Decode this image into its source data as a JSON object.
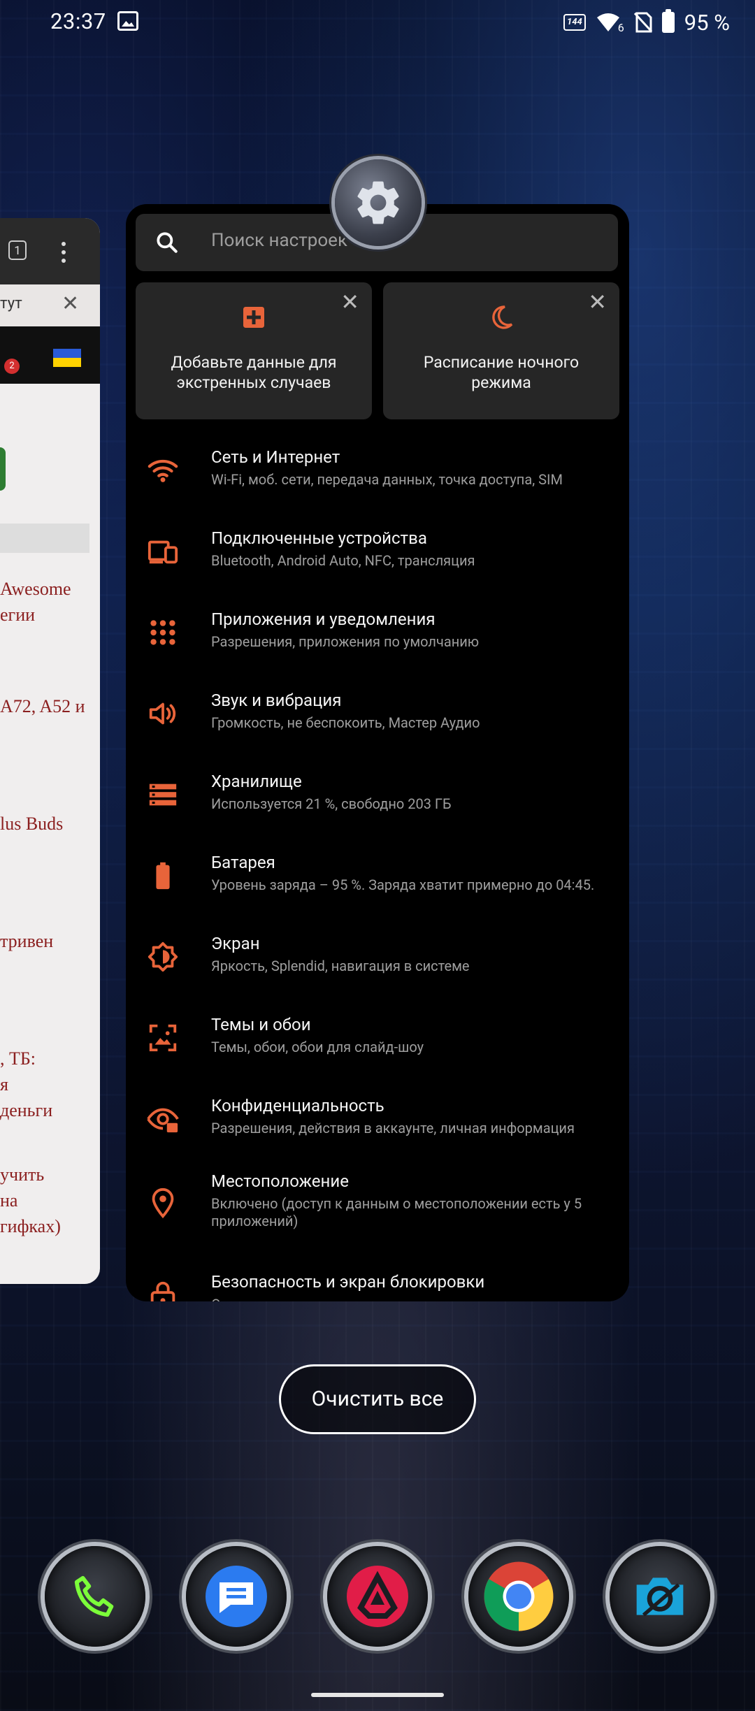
{
  "status_bar": {
    "time": "23:37",
    "refresh_rate": "144",
    "network": "6",
    "battery": "95 %"
  },
  "left_card": {
    "tab_count": "1",
    "tab_title": "тут",
    "close": "✕",
    "badge": "2",
    "snippets": [
      "Awesome",
      "егии",
      "A72, A52 и",
      "lus Buds",
      "тривен",
      ", ТБ:",
      "я",
      "деньги",
      "учить",
      "на",
      " гифках)"
    ]
  },
  "settings": {
    "search_placeholder": "Поиск настроек",
    "suggestions": [
      {
        "text": "Добавьте данные для экстренных случаев",
        "icon": "medical-cross-icon",
        "close": "✕"
      },
      {
        "text": "Расписание ночного режима",
        "icon": "moon-icon",
        "close": "✕"
      }
    ],
    "items": [
      {
        "title": "Сеть и Интернет",
        "subtitle": "Wi-Fi, моб. сети, передача данных, точка доступа, SIM",
        "icon": "wifi-icon"
      },
      {
        "title": "Подключенные устройства",
        "subtitle": "Bluetooth, Android Auto, NFC, трансляция",
        "icon": "devices-icon"
      },
      {
        "title": "Приложения и уведомления",
        "subtitle": "Разрешения, приложения по умолчанию",
        "icon": "apps-grid-icon"
      },
      {
        "title": "Звук и вибрация",
        "subtitle": "Громкость, не беспокоить, Мастер Аудио",
        "icon": "speaker-icon"
      },
      {
        "title": "Хранилище",
        "subtitle": "Используется 21 %, свободно 203 ГБ",
        "icon": "storage-icon"
      },
      {
        "title": "Батарея",
        "subtitle": "Уровень заряда – 95 %. Заряда хватит примерно до 04:45.",
        "icon": "battery-icon"
      },
      {
        "title": "Экран",
        "subtitle": "Яркость, Splendid, навигация в системе",
        "icon": "brightness-icon"
      },
      {
        "title": "Темы и обои",
        "subtitle": "Темы, обои, обои для слайд-шоу",
        "icon": "wallpaper-icon"
      },
      {
        "title": "Конфиденциальность",
        "subtitle": "Разрешения, действия в аккаунте, личная информация",
        "icon": "privacy-eye-icon"
      },
      {
        "title": "Местоположение",
        "subtitle": "Включено (доступ к данным о местоположении есть у 5 приложений)",
        "icon": "location-pin-icon"
      },
      {
        "title": "Безопасность и экран блокировки",
        "subtitle": "Отпечатки пальцев, распознавание лиц",
        "icon": "lock-icon"
      }
    ]
  },
  "clear_all": "Очистить все",
  "dock": [
    "phone-icon",
    "messages-icon",
    "armoury-crate-icon",
    "chrome-icon",
    "camera-icon"
  ],
  "colors": {
    "accent": "#e8643a",
    "card": "#000000",
    "tile": "#262626"
  }
}
